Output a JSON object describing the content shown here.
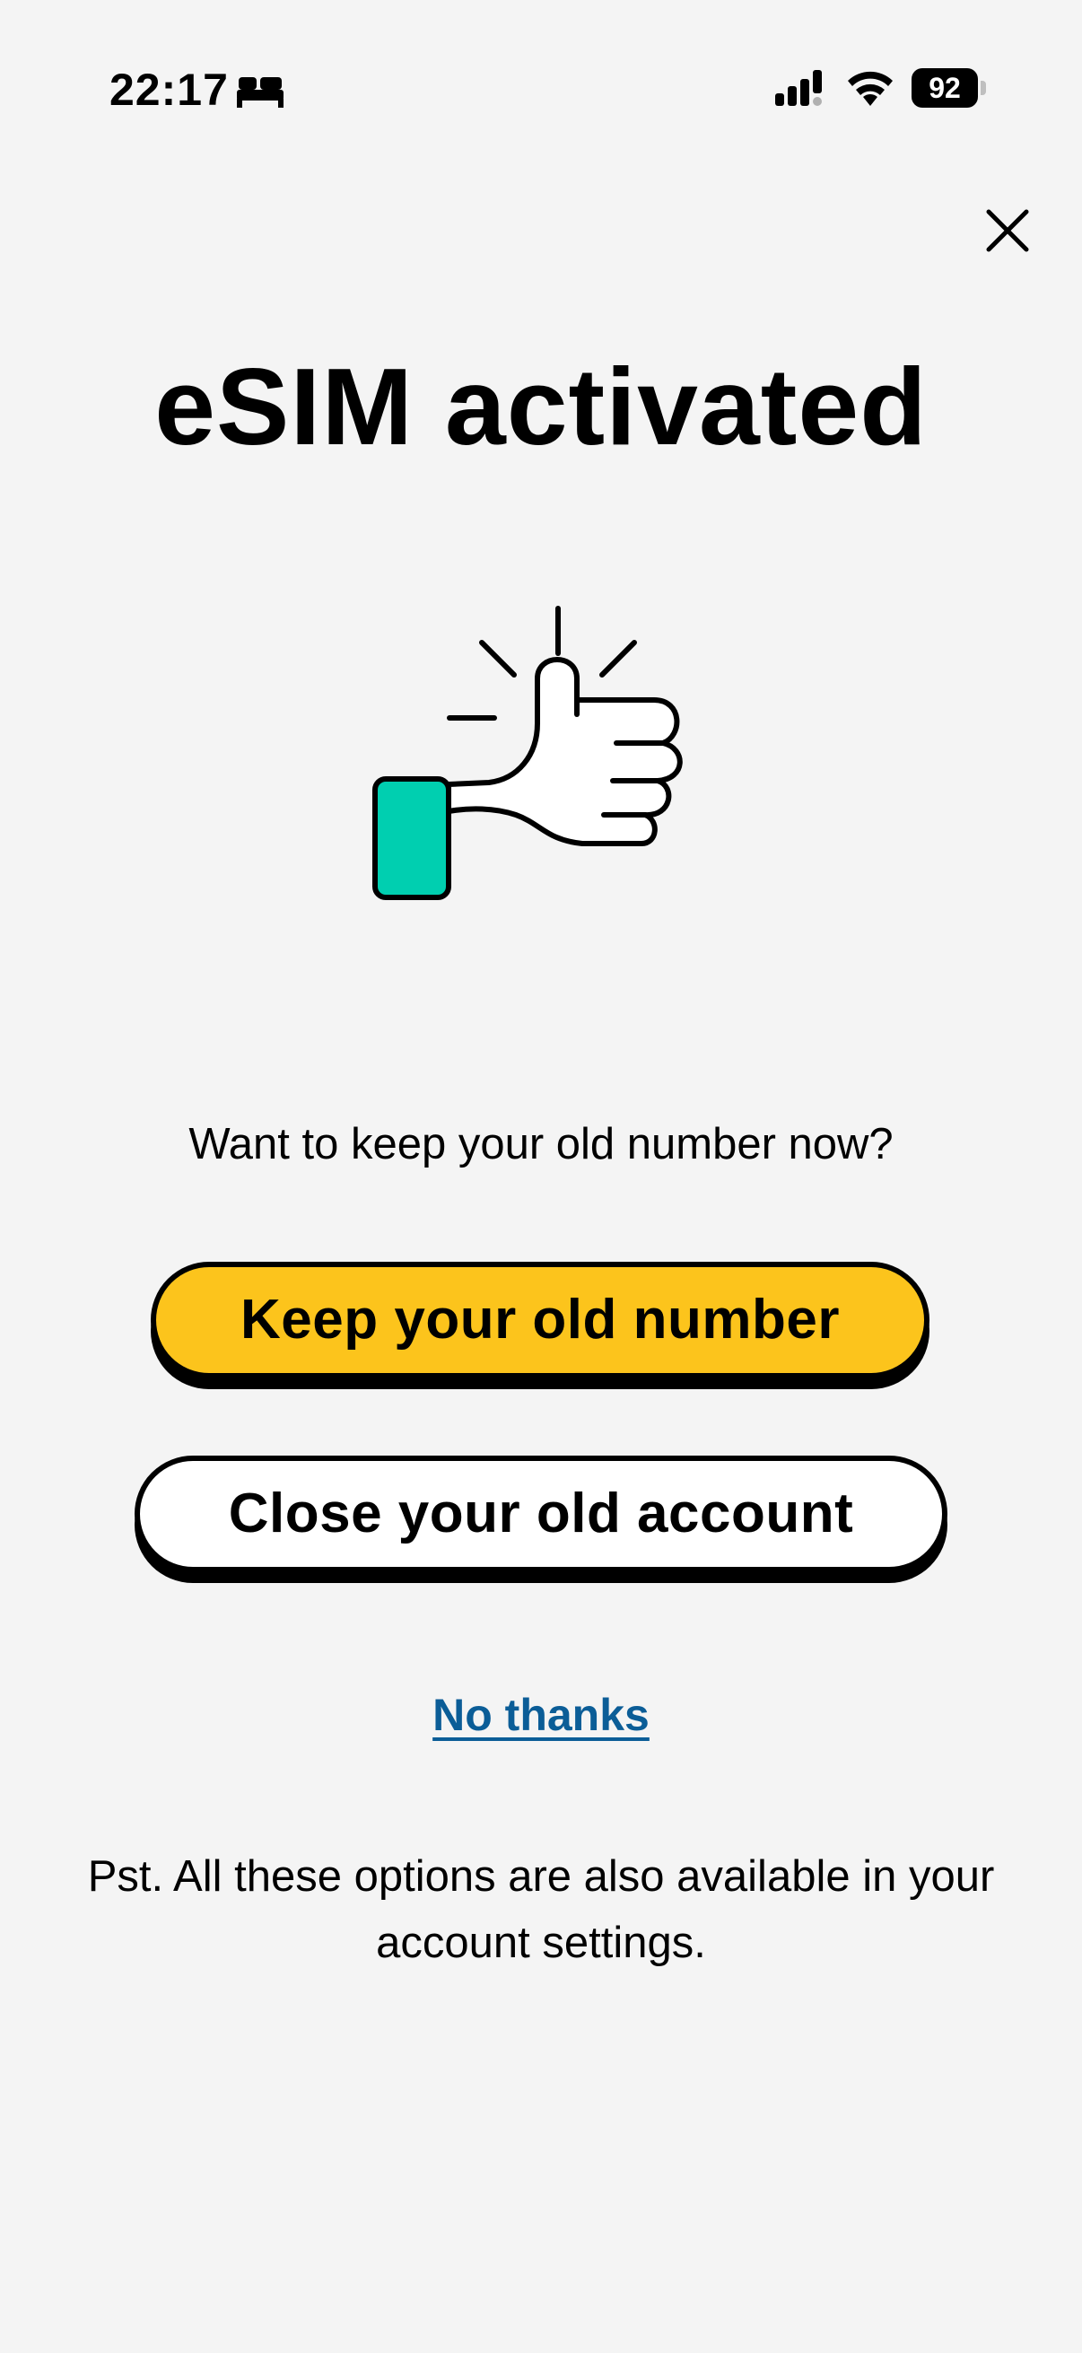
{
  "status_bar": {
    "time": "22:17",
    "sleep_icon": "bed-icon",
    "signal_icon": "cellular-signal-icon",
    "wifi_icon": "wifi-icon",
    "battery_level": "92"
  },
  "close_icon": "close-icon",
  "title": "eSIM activated",
  "illustration": "thumbs-up-icon",
  "question": "Want to keep your old number now?",
  "buttons": {
    "keep_label": "Keep your old number",
    "close_label": "Close your old account"
  },
  "link": {
    "no_thanks": "No thanks"
  },
  "footnote": "Pst. All these options are also available in your account settings.",
  "colors": {
    "background": "#f4f4f4",
    "primary_button": "#fcc41c",
    "secondary_button": "#ffffff",
    "link": "#0b5d97",
    "cuff": "#00cfb0"
  }
}
